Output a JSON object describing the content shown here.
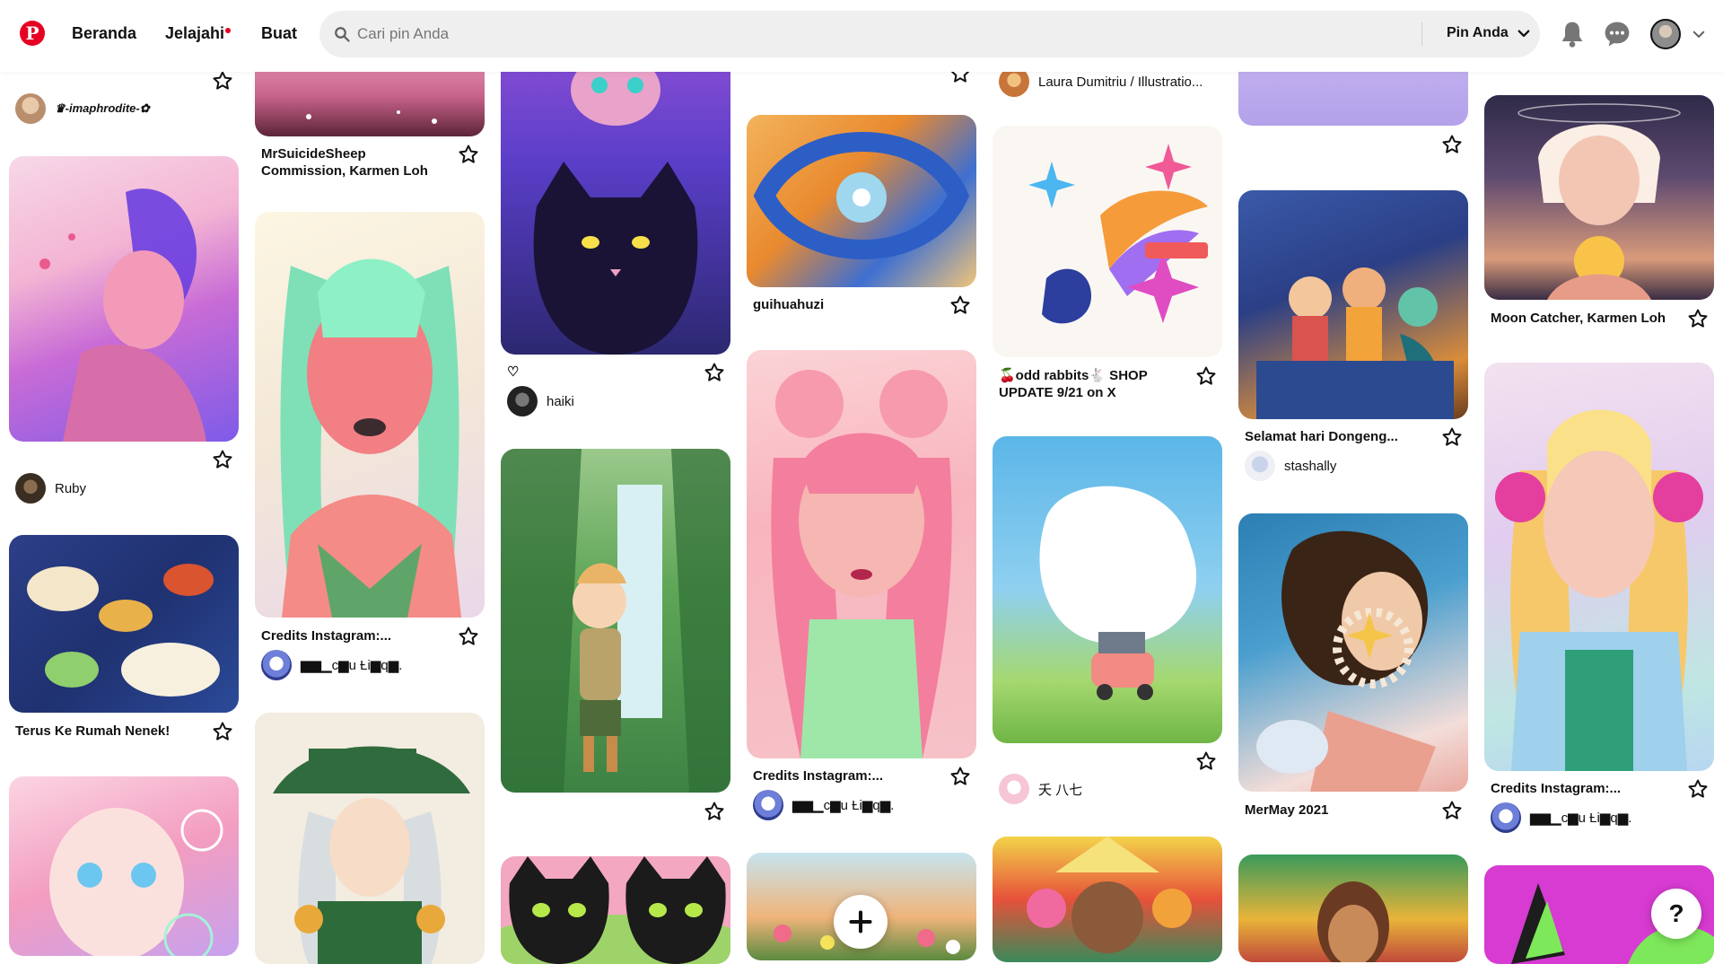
{
  "header": {
    "logo_letter": "P",
    "nav": {
      "home": "Beranda",
      "explore": "Jelajahi",
      "create": "Buat"
    },
    "search_placeholder": "Cari pin Anda",
    "scope_label": "Pin Anda",
    "accent": "#e60023"
  },
  "pins": [
    {
      "id": "c1p1",
      "author": "♛-imaphrodite-✿"
    },
    {
      "id": "c1p2",
      "author": "Ruby"
    },
    {
      "id": "c1p3",
      "title": "Terus Ke Rumah Nenek!"
    },
    {
      "id": "c2p1",
      "title": "MrSuicideSheep Commission, Karmen Loh"
    },
    {
      "id": "c2p2",
      "title": "Credits Instagram:...",
      "author": "▆▆▁c▆u Ƚi▆q▆."
    },
    {
      "id": "c3p1",
      "title": "♡",
      "author": "haiki"
    },
    {
      "id": "c4p1",
      "title": "guihuahuzi"
    },
    {
      "id": "c4p2",
      "title": "Credits Instagram:...",
      "author": "▆▆▁c▆u Ƚi▆q▆."
    },
    {
      "id": "c5p0",
      "author": "Laura Dumitriu / Illustratio..."
    },
    {
      "id": "c5p1",
      "title": "🍒odd rabbits🐇 SHOP UPDATE 9/21 on X"
    },
    {
      "id": "c5p2",
      "author": "夭 八七"
    },
    {
      "id": "c6p1",
      "title": "Selamat hari Dongeng...",
      "author": "stashally"
    },
    {
      "id": "c6p2",
      "title": "MerMay 2021"
    },
    {
      "id": "c7p1",
      "title": "Moon Catcher, Karmen Loh"
    },
    {
      "id": "c7p2",
      "title": "Credits Instagram:...",
      "author": "▆▆▁c▆u Ƚi▆q▆."
    }
  ],
  "fab_icon": "plus-icon",
  "help_label": "?"
}
